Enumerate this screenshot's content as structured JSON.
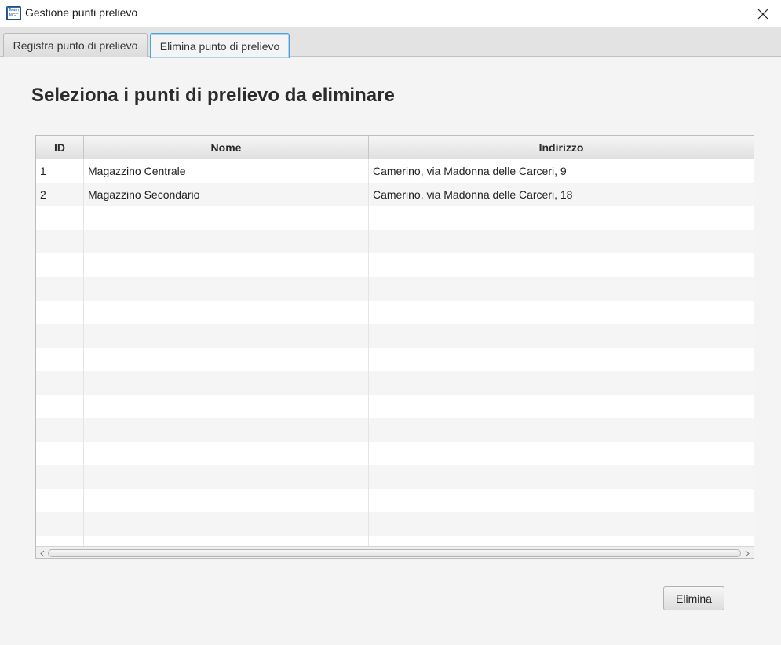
{
  "window": {
    "title": "Gestione punti prelievo",
    "icon_name": "app-logo-icon",
    "icon_text": [
      "Team",
      "MGC"
    ]
  },
  "tabs": [
    {
      "label": "Registra punto di prelievo",
      "selected": false
    },
    {
      "label": "Elimina punto di prelievo",
      "selected": true
    }
  ],
  "main": {
    "heading": "Seleziona i punti di prelievo da eliminare"
  },
  "table": {
    "columns": [
      "ID",
      "Nome",
      "Indirizzo"
    ],
    "rows": [
      {
        "id": "1",
        "nome": "Magazzino Centrale",
        "indirizzo": "Camerino, via Madonna delle Carceri, 9"
      },
      {
        "id": "2",
        "nome": "Magazzino Secondario",
        "indirizzo": "Camerino, via Madonna delle Carceri, 18"
      }
    ]
  },
  "actions": {
    "delete_label": "Elimina"
  },
  "colors": {
    "tab_focus": "#4ea0d9",
    "background": "#f4f4f4"
  }
}
